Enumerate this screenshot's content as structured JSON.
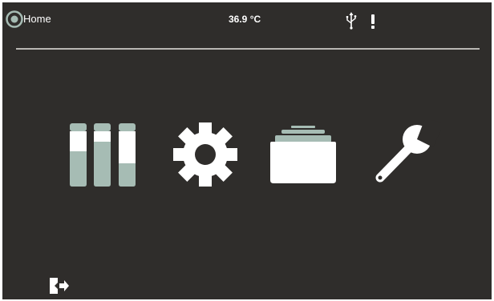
{
  "header": {
    "title": "Home",
    "temperature": "36.9 °C",
    "icons": {
      "home": "home-ring-icon",
      "usb": "usb-icon",
      "alert": "exclamation-icon"
    }
  },
  "menu": {
    "items": [
      {
        "id": "samples",
        "icon": "sample-tubes-icon"
      },
      {
        "id": "settings",
        "icon": "gear-icon"
      },
      {
        "id": "files",
        "icon": "file-drawer-icon"
      },
      {
        "id": "service",
        "icon": "wrench-icon"
      }
    ]
  },
  "footer": {
    "exit_icon": "exit-door-icon"
  },
  "colors": {
    "background": "#2f2d2b",
    "foreground": "#ffffff",
    "accent": "#a6bcb4",
    "divider": "#b9b7b3"
  }
}
